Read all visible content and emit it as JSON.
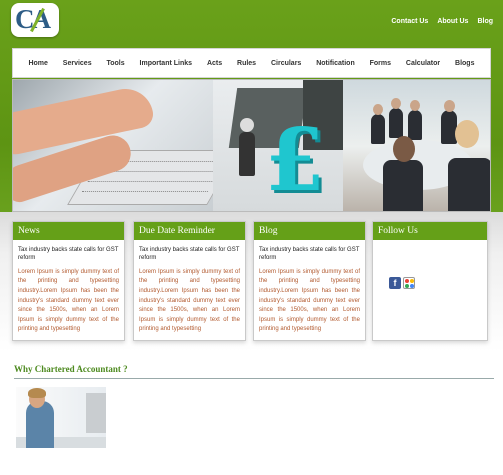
{
  "logo": {
    "text": "CA"
  },
  "top_links": [
    "Contact Us",
    "About Us",
    "Blog"
  ],
  "nav": [
    "Home",
    "Services",
    "Tools",
    "Important Links",
    "Acts",
    "Rules",
    "Circulars",
    "Notification",
    "Forms",
    "Calculator",
    "Blogs"
  ],
  "banner": {
    "symbol": "£"
  },
  "boxes": [
    {
      "heading": "News",
      "title": "Tax industry backs state calls for GST reform",
      "body": "Lorem Ipsum is simply dummy text of the printing and typesetting industry.Lorem Ipsum has been the industry's standard dummy text ever since the 1500s, when an Lorem Ipsum is simply dummy text of the printing and typesetting"
    },
    {
      "heading": "Due Date Reminder",
      "title": "Tax industry backs state calls for GST reform",
      "body": "Lorem Ipsum is simply dummy text of the printing and typesetting industry.Lorem Ipsum has been the industry's standard dummy text ever since the 1500s, when an Lorem Ipsum is simply dummy text of the printing and typesetting"
    },
    {
      "heading": "Blog",
      "title": "Tax industry backs state calls for GST reform",
      "body": "Lorem Ipsum is simply dummy text of the printing and typesetting industry.Lorem Ipsum has been the industry's standard dummy text ever since the 1500s, when an Lorem Ipsum is simply dummy text of the printing and typesetting"
    }
  ],
  "follow": {
    "heading": "Follow Us",
    "icons": [
      "facebook-icon",
      "google-plus-icon"
    ]
  },
  "why": {
    "heading": "Why Chartered Accountant ?"
  },
  "colors": {
    "brand_green": "#65a018",
    "body_text": "#b25a2f",
    "heading_green": "#4d8a1f"
  }
}
